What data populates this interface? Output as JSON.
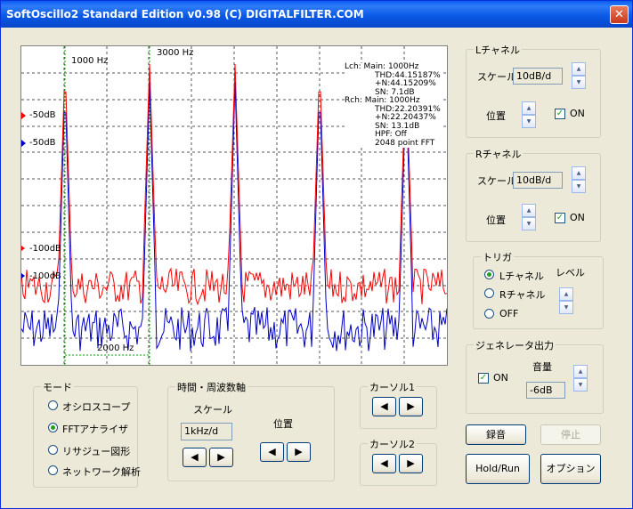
{
  "window": {
    "title": "SoftOscillo2 Standard Edition v0.98 (C) DIGITALFILTER.COM",
    "close": "✕"
  },
  "scope": {
    "markers": {
      "m1": "1000 Hz",
      "m2": "3000 Hz",
      "m3": "2000 Hz"
    },
    "levels": {
      "l_top": "-50dB",
      "r_top": "-50dB",
      "l_bot": "-100dB",
      "r_bot": "-100dB"
    },
    "info_lines": [
      "Lch:   Main: 1000Hz",
      "THD:44.15187%",
      "+N:44.15209%",
      "SN:  7.1dB",
      "Rch:  Main: 1000Hz",
      "THD:22.20391%",
      "+N:22.20437%",
      "SN:  13.1dB",
      "HPF: Off",
      "2048 point FFT"
    ],
    "colors": {
      "lch": "#ff0000",
      "rch": "#0000cc",
      "marker": "#00aa00"
    }
  },
  "lch": {
    "legend": "Lチャネル",
    "scale_label": "スケール",
    "scale": "10dB/d",
    "pos_label": "位置",
    "on": "ON"
  },
  "rch": {
    "legend": "Rチャネル",
    "scale_label": "スケール",
    "scale": "10dB/d",
    "pos_label": "位置",
    "on": "ON"
  },
  "trigger": {
    "legend": "トリガ",
    "opt1": "Lチャネル",
    "opt2": "Rチャネル",
    "opt3": "OFF",
    "level": "レベル"
  },
  "gen": {
    "legend": "ジェネレータ出力",
    "on": "ON",
    "vol_label": "音量",
    "vol": "-6dB"
  },
  "mode": {
    "legend": "モード",
    "opt1": "オシロスコープ",
    "opt2": "FFTアナライザ",
    "opt3": "リサジュー図形",
    "opt4": "ネットワーク解析"
  },
  "axis": {
    "legend": "時間・周波数軸",
    "scale_label": "スケール",
    "scale": "1kHz/d",
    "pos_label": "位置"
  },
  "cursor1": {
    "legend": "カーソル1"
  },
  "cursor2": {
    "legend": "カーソル2"
  },
  "buttons": {
    "record": "録音",
    "stop": "停止",
    "hold": "Hold/Run",
    "option": "オプション"
  }
}
